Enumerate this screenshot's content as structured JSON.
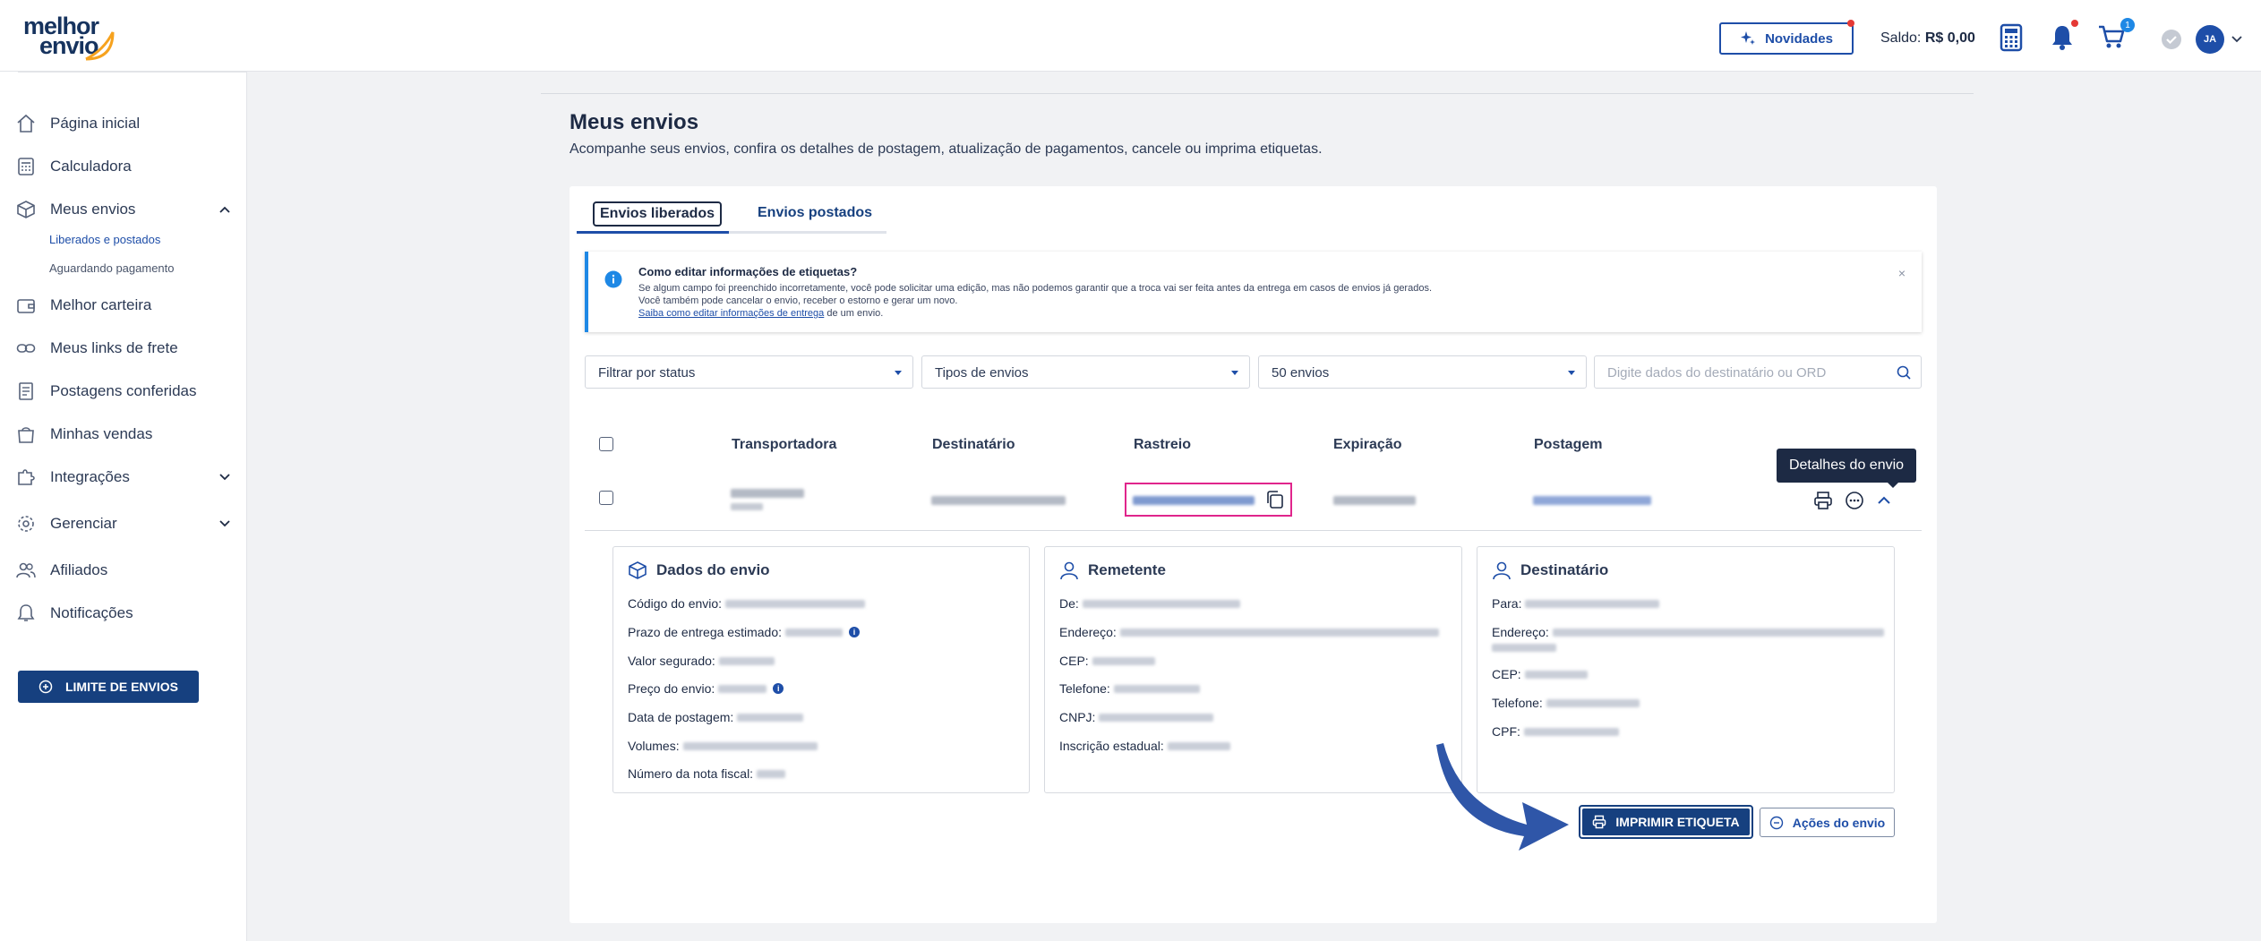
{
  "header": {
    "logo_line1": "melhor",
    "logo_line2": "envio",
    "novidades_label": "Novidades",
    "saldo_label": "Saldo:",
    "saldo_value": "R$ 0,00",
    "cart_count": "1",
    "avatar_initials": "JA"
  },
  "sidebar": {
    "items": [
      {
        "label": "Página inicial",
        "icon": "home-icon"
      },
      {
        "label": "Calculadora",
        "icon": "calculator-icon"
      },
      {
        "label": "Meus envios",
        "icon": "box-icon"
      },
      {
        "label": "Melhor carteira",
        "icon": "wallet-icon"
      },
      {
        "label": "Meus links de frete",
        "icon": "link-icon"
      },
      {
        "label": "Postagens conferidas",
        "icon": "checklist-icon"
      },
      {
        "label": "Minhas vendas",
        "icon": "shopping-bag-icon"
      },
      {
        "label": "Integrações",
        "icon": "puzzle-icon"
      },
      {
        "label": "Gerenciar",
        "icon": "gear-icon"
      },
      {
        "label": "Afiliados",
        "icon": "users-icon"
      },
      {
        "label": "Notificações",
        "icon": "bell-icon"
      }
    ],
    "subitems": [
      "Liberados e postados",
      "Aguardando pagamento"
    ],
    "limite_label": "LIMITE DE ENVIOS"
  },
  "page": {
    "title": "Meus envios",
    "subtitle": "Acompanhe seus envios, confira os detalhes de postagem, atualização de pagamentos, cancele ou imprima etiquetas."
  },
  "tabs": [
    "Envios liberados",
    "Envios postados"
  ],
  "info": {
    "title": "Como editar informações de etiquetas?",
    "line1": "Se algum campo foi preenchido incorretamente, você pode solicitar uma edição, mas não podemos garantir que a troca vai ser feita antes da entrega em casos de envios já gerados.",
    "line2": "Você também pode cancelar o envio, receber o estorno e gerar um novo.",
    "link": "Saiba como editar informações de entrega",
    "line3_suffix": " de um envio.",
    "close": "×"
  },
  "filters": {
    "status": "Filtrar por status",
    "tipos": "Tipos de envios",
    "count": "50 envios",
    "search_placeholder": "Digite dados do destinatário ou ORD"
  },
  "table": {
    "headers": [
      "Transportadora",
      "Destinatário",
      "Rastreio",
      "Expiração",
      "Postagem"
    ]
  },
  "tooltip": "Detalhes do envio",
  "dados_envio": {
    "title": "Dados do envio",
    "fields": [
      "Código do envio:",
      "Prazo de entrega estimado:",
      "Valor segurado:",
      "Preço do envio:",
      "Data de postagem:",
      "Volumes:",
      "Número da nota fiscal:"
    ]
  },
  "remetente": {
    "title": "Remetente",
    "fields": [
      "De:",
      "Endereço:",
      "CEP:",
      "Telefone:",
      "CNPJ:",
      "Inscrição estadual:"
    ]
  },
  "destinatario": {
    "title": "Destinatário",
    "fields": [
      "Para:",
      "Endereço:",
      "CEP:",
      "Telefone:",
      "CPF:"
    ]
  },
  "buttons": {
    "imprimir": "IMPRIMIR ETIQUETA",
    "acoes": "Ações do envio"
  },
  "colors": {
    "brand": "#16407f",
    "accent": "#1e4ea8",
    "highlight": "#e0258c",
    "arrow": "#2f56a8"
  }
}
